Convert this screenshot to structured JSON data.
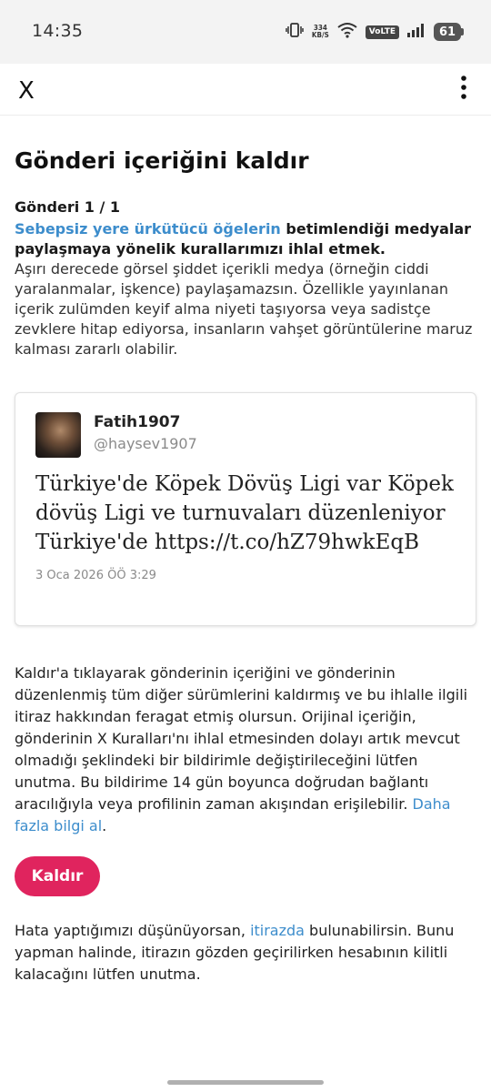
{
  "status_bar": {
    "time": "14:35",
    "net_speed_value": "334",
    "net_speed_unit": "KB/S",
    "volte_label": "VoLTE",
    "battery_level": "61"
  },
  "header": {
    "close_label": "X",
    "more_icon": "more-vertical-icon"
  },
  "page": {
    "title": "Gönderi içeriğini kaldır",
    "post_counter": "Gönderi 1 / 1",
    "rule_link_text": "Sebepsiz yere ürkütücü öğelerin",
    "rule_rest_text": " betimlendiği medyalar paylaşmaya yönelik kurallarımızı ihlal etmek.",
    "rule_description": "Aşırı derecede görsel şiddet içerikli medya (örneğin ciddi yaralanmalar, işkence) paylaşamazsın. Özellikle yayınlanan içerik zulümden keyif alma niyeti taşıyorsa veya sadistçe zevklere hitap ediyorsa, insanların vahşet görüntülerine maruz kalması zararlı olabilir."
  },
  "tweet": {
    "author_name": "Fatih1907",
    "author_handle": "@haysev1907",
    "text": "Türkiye'de Köpek Dövüş Ligi var Köpek dövüş Ligi ve turnuvaları düzenleniyor Türkiye'de https://t.co/hZ79hwkEqB",
    "date": "3 Oca 2026 ÖÖ 3:29"
  },
  "info": {
    "text": "Kaldır'a tıklayarak gönderinin içeriğini ve gönderinin düzenlenmiş tüm diğer sürümlerini kaldırmış ve bu ihlalle ilgili itiraz hakkından feragat etmiş olursun. Orijinal içeriğin, gönderinin X Kuralları'nı ihlal etmesinden dolayı artık mevcut olmadığı şeklindeki bir bildirimle değiştirileceğini lütfen unutma. Bu bildirime 14 gün boyunca doğrudan bağlantı aracılığıyla veya profilinin zaman akışından erişilebilir. ",
    "more_link": "Daha fazla bilgi al",
    "after_link": "."
  },
  "remove_button": {
    "label": "Kaldır",
    "color": "#e0245e"
  },
  "appeal": {
    "before_link": "Hata yaptığımızı düşünüyorsan, ",
    "link_text": "itirazda",
    "after_link": " bulunabilirsin. Bunu yapman halinde, itirazın gözden geçirilirken hesabının kilitli kalacağını lütfen unutma."
  },
  "colors": {
    "link": "#3d8dcc",
    "accent": "#e0245e"
  }
}
